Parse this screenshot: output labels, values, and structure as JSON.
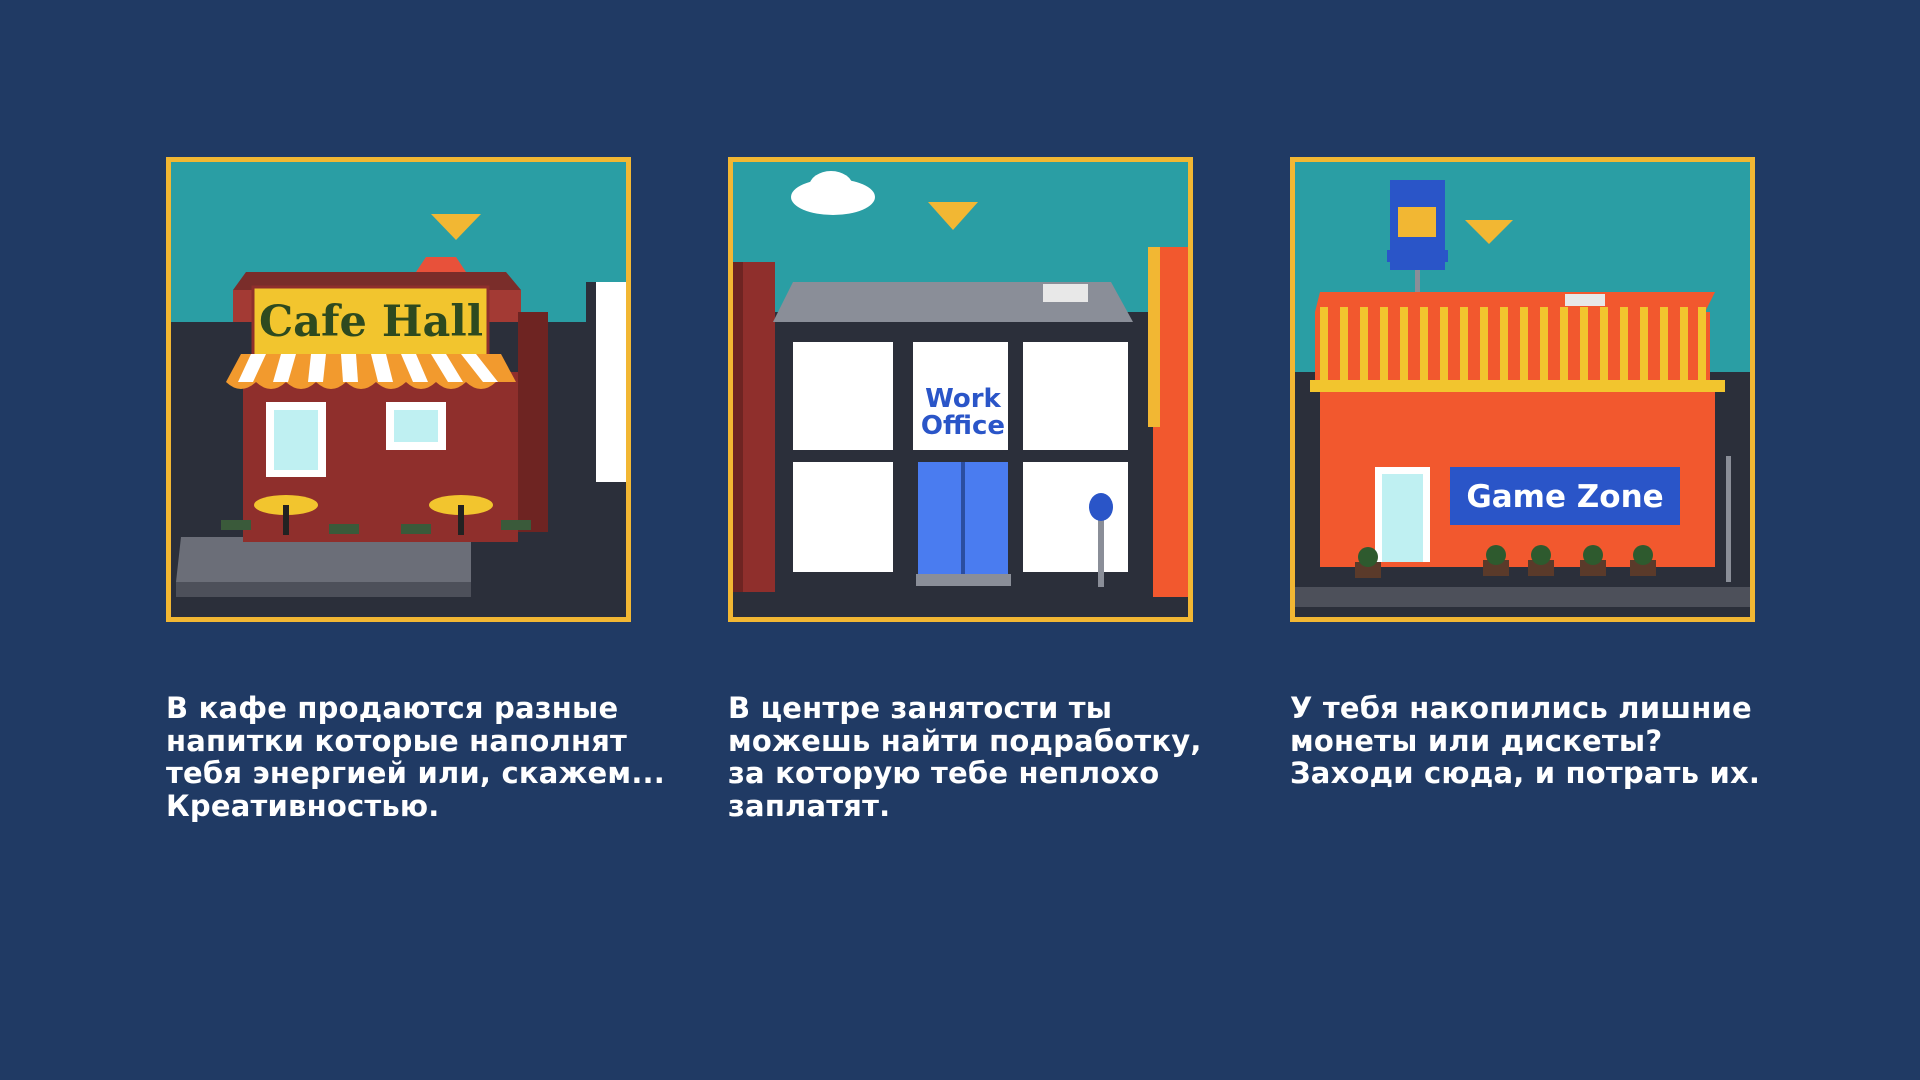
{
  "cards": [
    {
      "building": "cafe",
      "sign": "Cafe Hall",
      "pointer_icon": "triangle-marker-icon",
      "description": [
        "В кафе продаются разные",
        "напитки которые наполнят",
        "тебя энергией или, скажем...",
        "Креативностью."
      ]
    },
    {
      "building": "office",
      "sign_line1": "Work",
      "sign_line2": "Office",
      "pointer_icon": "triangle-marker-icon",
      "description": [
        "В центре занятости ты",
        "можешь найти подработку,",
        "за которую тебе неплохо",
        "заплатят."
      ]
    },
    {
      "building": "arcade",
      "sign": "Game Zone",
      "pointer_icon": "triangle-marker-icon",
      "description": [
        "У тебя накопились лишние",
        "монеты или дискеты?",
        "Заходи сюда, и потрать их."
      ]
    }
  ],
  "colors": {
    "background": "#203a64",
    "frame_border": "#f2b733",
    "sky": "#2a9ea4",
    "ground": "#2b2f3a",
    "marker": "#f2b733"
  }
}
